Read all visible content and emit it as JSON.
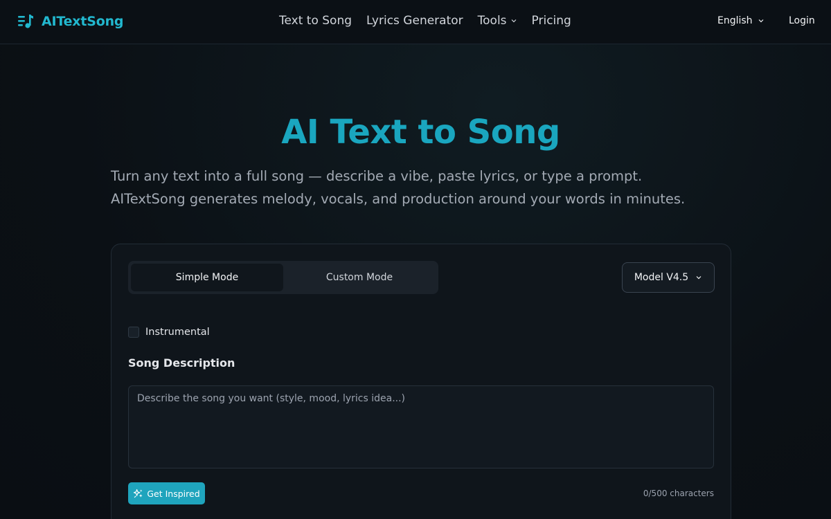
{
  "header": {
    "logo_text": "AITextSong",
    "nav": [
      {
        "label": "Text to Song"
      },
      {
        "label": "Lyrics Generator"
      },
      {
        "label": "Tools"
      },
      {
        "label": "Pricing"
      }
    ],
    "language": "English",
    "login": "Login"
  },
  "hero": {
    "title": "AI Text to Song",
    "subtitle": "Turn any text into a full song — describe a vibe, paste lyrics, or type a prompt. AITextSong generates melody, vocals, and production around your words in minutes."
  },
  "form": {
    "modes": [
      "Simple Mode",
      "Custom Mode"
    ],
    "active_mode": "Simple Mode",
    "model": "Model V4.5",
    "instrumental_label": "Instrumental",
    "instrumental_checked": false,
    "description_label": "Song Description",
    "description_value": "",
    "description_placeholder": "Describe the song you want (style, mood, lyrics idea...)",
    "inspire_label": "Get Inspired",
    "char_count": "0/500 characters"
  },
  "colors": {
    "accent": "#1fa4bd",
    "logo": "#22b8cf",
    "background": "#0b1015"
  },
  "icons": {
    "logo": "music-list-icon",
    "dropdown": "chevron-down-icon",
    "inspire": "sparkles-icon"
  }
}
